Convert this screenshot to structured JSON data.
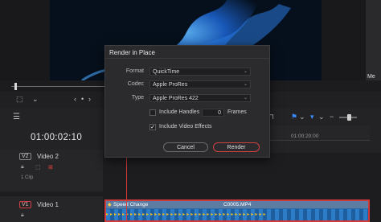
{
  "viewer": {
    "right_panel_label": "Me"
  },
  "timeline": {
    "timecode": "01:00:02:10",
    "ruler_label": "01:00:20:00"
  },
  "tracks": [
    {
      "tag": "V2",
      "name": "Video 2",
      "sub": "1 Clip"
    },
    {
      "tag": "V1",
      "name": "Video 1"
    }
  ],
  "clip": {
    "speed_label": "Speed Change",
    "filename": "C0005.MP4"
  },
  "dialog": {
    "title": "Render in Place",
    "format": {
      "label": "Format",
      "value": "QuickTime"
    },
    "codec": {
      "label": "Codec",
      "value": "Apple ProRes"
    },
    "type": {
      "label": "Type",
      "value": "Apple ProRes 422"
    },
    "include_handles": {
      "label": "Include Handles",
      "value": "0",
      "unit": "Frames",
      "checked": false
    },
    "include_video_effects": {
      "label": "Include Video Effects",
      "checked": true
    },
    "cancel_label": "Cancel",
    "render_label": "Render"
  },
  "colors": {
    "accent_red": "#d03a3a",
    "clip_blue": "#2f6aa3",
    "dialog_bg": "#2b2b2e"
  }
}
